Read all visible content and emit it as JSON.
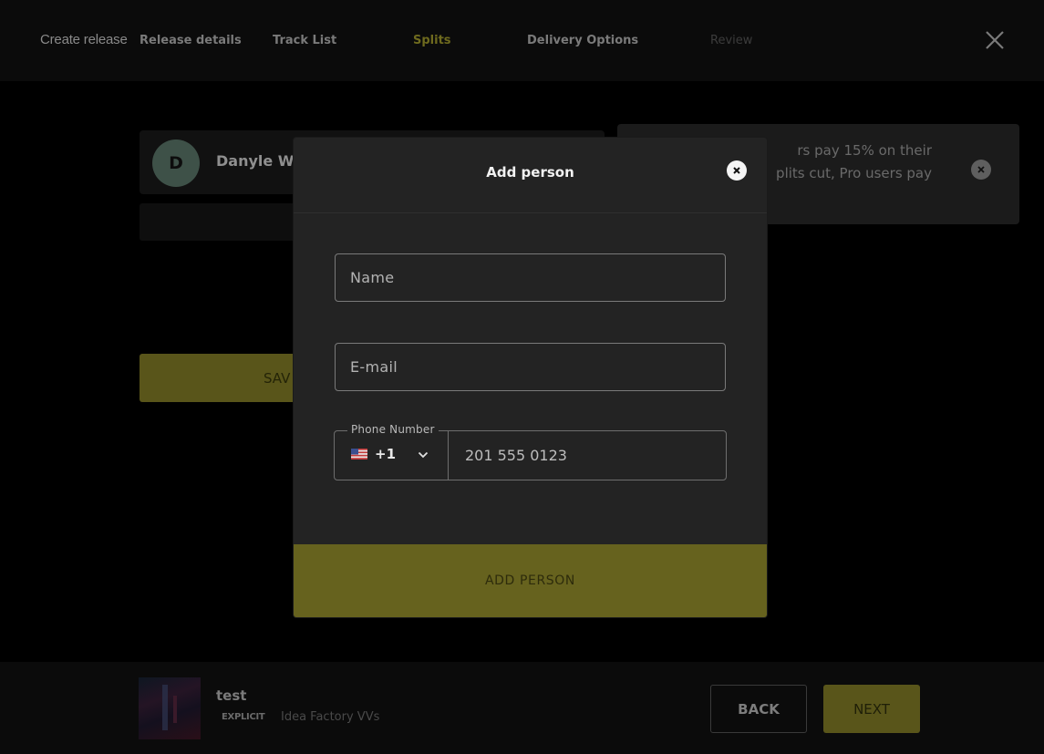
{
  "nav": {
    "title": "Create release",
    "steps": [
      {
        "label": "Release details"
      },
      {
        "label": "Track List"
      },
      {
        "label": "Splits"
      },
      {
        "label": "Delivery Options"
      },
      {
        "label": "Review"
      }
    ],
    "close_icon": "close-icon"
  },
  "background": {
    "avatar_initial": "D",
    "person_name": "Danyle Wi",
    "save_label": "SAV",
    "notice_lines": [
      "rs pay 15% on their",
      "plits cut, Pro users pay"
    ]
  },
  "modal": {
    "title": "Add person",
    "name_placeholder": "Name",
    "email_placeholder": "E-mail",
    "phone_label": "Phone Number",
    "dial_code": "+1",
    "phone_placeholder": "201 555 0123",
    "submit_label": "ADD PERSON"
  },
  "footer": {
    "release_title": "test",
    "explicit_badge": "EXPLICIT",
    "artist": "Idea Factory VVs",
    "back_label": "BACK",
    "next_label": "NEXT"
  },
  "colors": {
    "accent": "#66621e",
    "active_step": "#6e6a1e",
    "modal_bg": "#232323"
  }
}
